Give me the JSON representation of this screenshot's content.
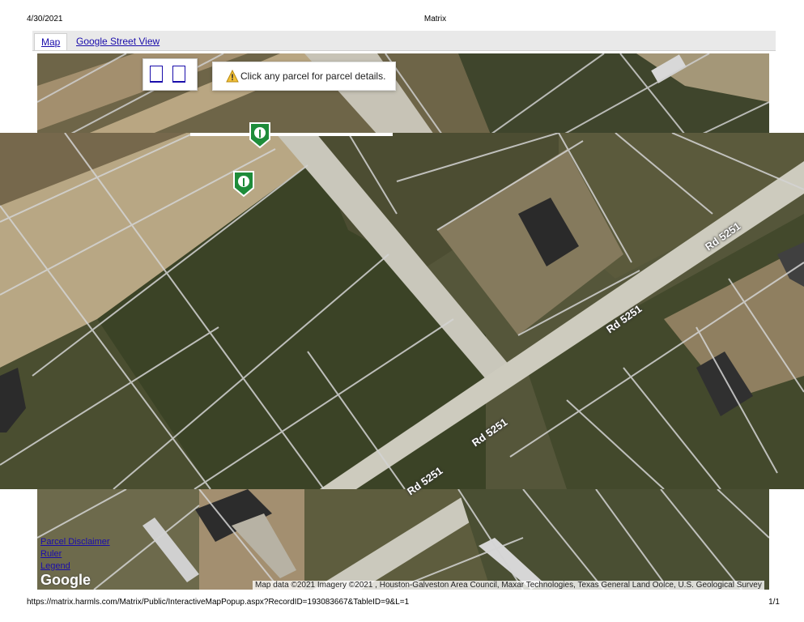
{
  "print": {
    "date": "4/30/2021",
    "title": "Matrix",
    "url": "https://matrix.harmls.com/Matrix/Public/InteractiveMapPopup.aspx?RecordID=193083667&TableID=9&L=1",
    "page": "1/1"
  },
  "tabs": [
    {
      "label": "Map",
      "active": true
    },
    {
      "label": "Google Street View",
      "active": false
    }
  ],
  "map": {
    "zoom_in_icon": "zoom-in-icon",
    "zoom_out_icon": "zoom-out-icon",
    "info_message": "Click any parcel for parcel details.",
    "info_icon": "warning-icon",
    "pin_icon": "property-pin-icon",
    "pin_color": "#1e8c3a",
    "road_labels": [
      "Rd 5251",
      "Rd 5251",
      "Rd 5251",
      "Rd 5251"
    ],
    "links": [
      "Parcel Disclaimer",
      "Ruler",
      "Legend"
    ],
    "logo": "Google",
    "attribution": "Map data ©2021 Imagery ©2021 , Houston-Galveston Area Council, Maxar Technologies, Texas General Land Oolce, U.S. Geological Survey"
  }
}
